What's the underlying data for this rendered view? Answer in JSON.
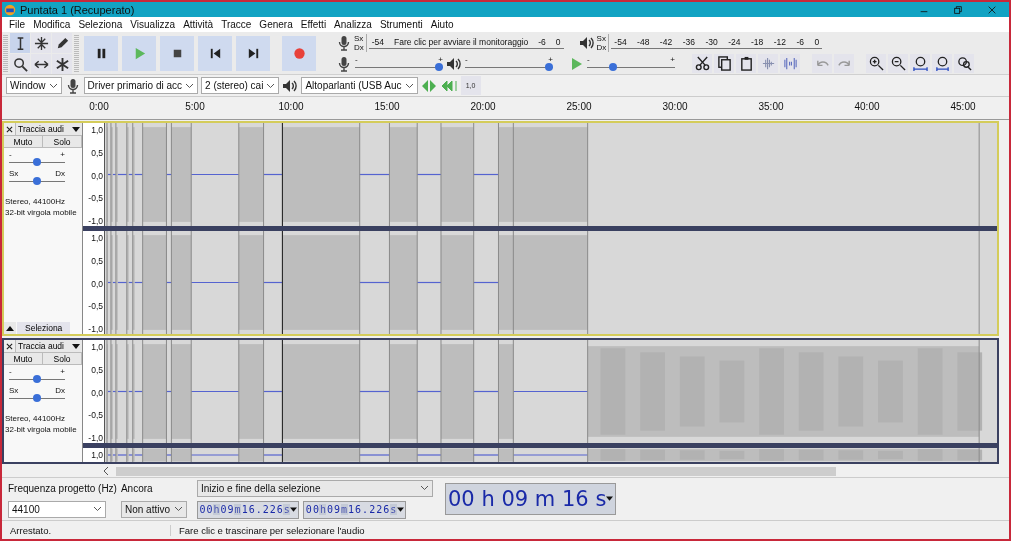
{
  "window": {
    "title": "Puntata 1 (Recuperato)"
  },
  "menu": [
    "File",
    "Modifica",
    "Seleziona",
    "Visualizza",
    "Attività",
    "Tracce",
    "Genera",
    "Effetti",
    "Analizza",
    "Strumenti",
    "Aiuto"
  ],
  "record_meter": {
    "channels": [
      "Sx",
      "Dx"
    ],
    "ticks": [
      "-54",
      "-6",
      "0"
    ],
    "message": "Fare clic per avviare il monitoraggio"
  },
  "playback_meter": {
    "channels": [
      "Sx",
      "Dx"
    ],
    "ticks": [
      "-54",
      "-48",
      "-42",
      "-36",
      "-30",
      "-24",
      "-18",
      "-12",
      "-6",
      "0"
    ]
  },
  "record_volume": {
    "minus": "-",
    "plus": "+",
    "level": 0.95
  },
  "playback_volume": {
    "minus": "-",
    "plus": "+",
    "level": 0.95
  },
  "play_speed": {
    "minus": "-",
    "plus": "+",
    "level": 0.3
  },
  "devices": {
    "host": "Window",
    "recording": "Driver primario di acc",
    "channels": "2 (stereo) cai",
    "playback": "Altoparlanti (USB Auc",
    "meter_label": "1,0"
  },
  "ruler": [
    "0:00",
    "5:00",
    "10:00",
    "15:00",
    "20:00",
    "25:00",
    "30:00",
    "35:00",
    "40:00",
    "45:00"
  ],
  "tracks": [
    {
      "name": "Traccia audi",
      "selected": true,
      "mute": "Muto",
      "solo": "Solo",
      "gain": {
        "minus": "-",
        "plus": "+",
        "level": 0.5
      },
      "pan": {
        "left": "Sx",
        "right": "Dx",
        "level": 0.5
      },
      "info": [
        "Stereo, 44100Hz",
        "32-bit virgola mobile"
      ],
      "select_button": "Seleziona",
      "channels": [
        {
          "axis": [
            "1,0",
            "0,5",
            "0,0",
            "-0,5",
            "-1,0"
          ]
        },
        {
          "axis": [
            "1,0",
            "0,5",
            "0,0",
            "-0,5",
            "-1,0"
          ]
        }
      ]
    },
    {
      "name": "Traccia audi",
      "selected": false,
      "mute": "Muto",
      "solo": "Solo",
      "gain": {
        "minus": "-",
        "plus": "+",
        "level": 0.5
      },
      "pan": {
        "left": "Sx",
        "right": "Dx",
        "level": 0.5
      },
      "info": [
        "Stereo, 44100Hz",
        "32-bit virgola mobile"
      ],
      "channels": [
        {
          "axis": [
            "1,0",
            "0,5",
            "0,0",
            "-0,5",
            "-1,0"
          ]
        },
        {
          "axis": [
            "1,0"
          ]
        }
      ]
    }
  ],
  "selection_bar": {
    "rate_label": "Frequenza progetto (Hz)",
    "rate": "44100",
    "snap_label": "Ancora",
    "snap": "Non attivo",
    "mode": "Inizio e fine della selezione",
    "start": "00h09m16.226s",
    "end": "00h09m16.226s"
  },
  "audio_position": "00 h 09 m 16 s",
  "status": [
    "Arrestato.",
    "Fare clic e trascinare per selezionare l'audio"
  ]
}
